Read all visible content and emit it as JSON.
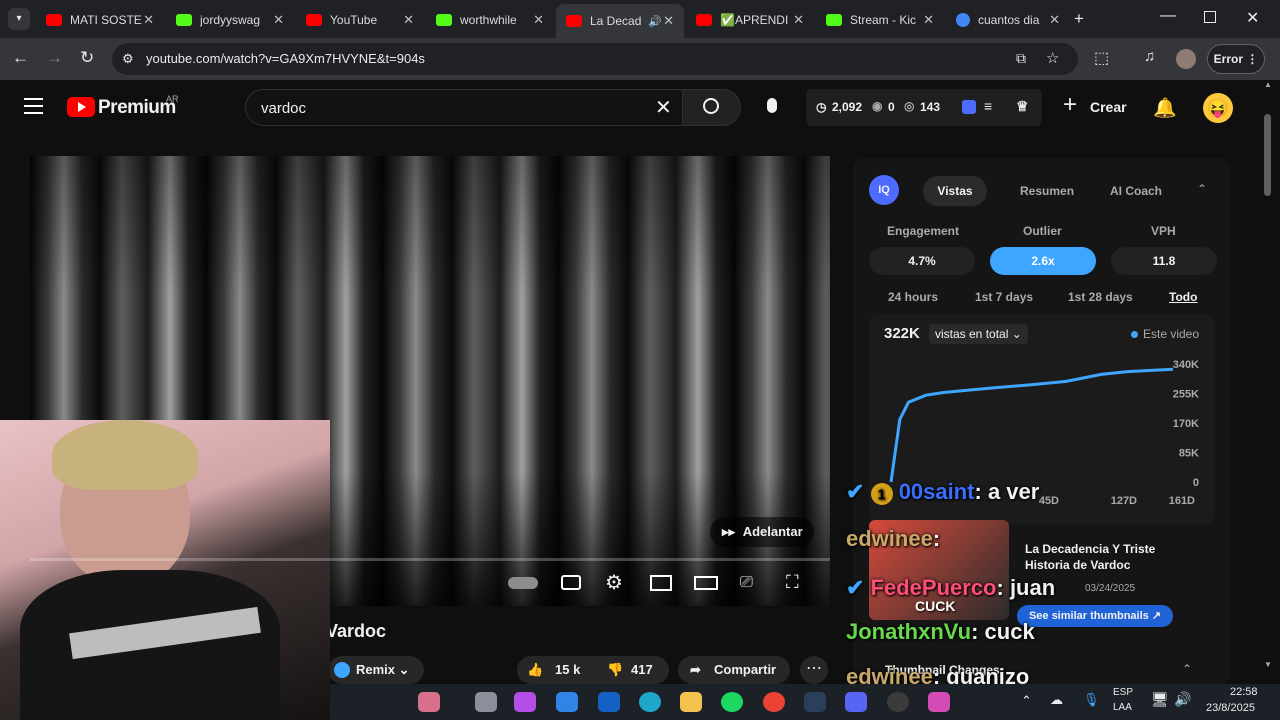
{
  "browser": {
    "tabs": [
      {
        "title": "MATI SOSTE",
        "color": "#ff0000"
      },
      {
        "title": "jordyyswag",
        "color": "#53fc18"
      },
      {
        "title": "YouTube",
        "color": "#ff0000"
      },
      {
        "title": "worthwhile",
        "color": "#53fc18"
      },
      {
        "title": "La Decad",
        "color": "#ff0000"
      },
      {
        "title": "✅APRENDI",
        "color": "#ff0000"
      },
      {
        "title": "Stream - Kic",
        "color": "#53fc18"
      },
      {
        "title": "cuantos dia",
        "color": "#4285f4"
      }
    ],
    "url": "youtube.com/watch?v=GA9Xm7HVYNE&t=904s",
    "profile_label": "Error"
  },
  "youtube": {
    "brand": "Premium",
    "region": "AR",
    "search_value": "vardoc",
    "stats": {
      "views": "2,092",
      "zero": "0",
      "watching": "143"
    },
    "create_label": "Crear",
    "video": {
      "skip_label": "Adelantar",
      "title": "Vardoc",
      "remix_label": "Remix",
      "likes": "15 k",
      "dislikes": "417",
      "share_label": "Compartir"
    }
  },
  "panel": {
    "badge": "IQ",
    "tabs": [
      "Vistas",
      "Resumen",
      "AI Coach"
    ],
    "metrics": [
      {
        "label": "Engagement",
        "value": "4.7%"
      },
      {
        "label": "Outlier",
        "value": "2.6x"
      },
      {
        "label": "VPH",
        "value": "11.8"
      }
    ],
    "ranges": [
      "24 hours",
      "1st 7 days",
      "1st 28 days",
      "Todo"
    ],
    "total": "322K",
    "dropdown": "vistas en total",
    "legend": "Este video",
    "thumb_title": "La Decadencia Y Triste Historia de Vardoc",
    "thumb_date": "03/24/2025",
    "thumb_text": "CUCK",
    "similar_label": "See similar thumbnails",
    "section_label": "Thumbnail Changes"
  },
  "chart_data": {
    "type": "line",
    "x": [
      0,
      5,
      10,
      20,
      30,
      45,
      60,
      80,
      100,
      110,
      120,
      135,
      150,
      161
    ],
    "values": [
      0,
      180000,
      230000,
      250000,
      258000,
      265000,
      272000,
      280000,
      290000,
      300000,
      310000,
      318000,
      322000,
      325000
    ],
    "ytick_labels": [
      "0",
      "85K",
      "170K",
      "255K",
      "340K"
    ],
    "xtick_labels": [
      "45D",
      "127D",
      "161D"
    ],
    "ylim": [
      0,
      340000
    ],
    "xlim": [
      0,
      161
    ],
    "color": "#3ea6ff"
  },
  "chat": [
    {
      "user": "00saint",
      "text": ": a ver",
      "color": "#3b6dff"
    },
    {
      "user": "edwinee",
      "text": ":",
      "color": "#c8a96a"
    },
    {
      "user": "FedePuerco",
      "text": ": juan",
      "color": "#ff4d7a"
    },
    {
      "user": "JonathxnVu",
      "text": ": cuck",
      "color": "#66d94c"
    },
    {
      "user": "edwinee",
      "text": ": guanizo",
      "color": "#c8a96a"
    }
  ],
  "taskbar": {
    "lang": "ESP",
    "layout": "LAA",
    "time": "22:58",
    "date": "23/8/2025"
  }
}
